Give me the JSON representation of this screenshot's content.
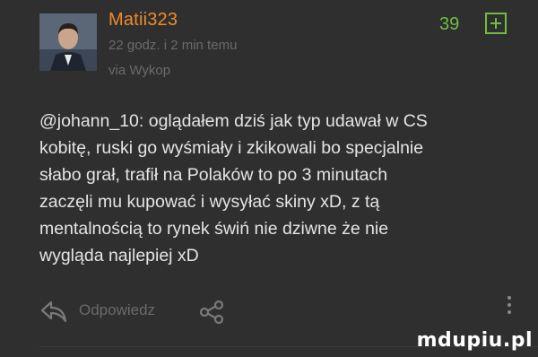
{
  "comment": {
    "author": "Matii323",
    "time": "22 godz. i 2 min temu",
    "via": "via Wykop",
    "votes": "39",
    "body_lines": [
      "@johann_10: oglądałem dziś jak typ udawał w CS",
      "kobitę, ruski go wyśmiały i zkikowali bo specjalnie",
      "słabo grał, trafił na Polaków to po 3 minutach",
      "zaczęli mu kupować i wysyłać skiny xD, z tą",
      "mentalnością to rynek świń nie dziwne że nie",
      "wygląda najlepiej xD"
    ]
  },
  "actions": {
    "reply_label": "Odpowiedz",
    "reply_icon": "reply-icon",
    "share_icon": "share-icon",
    "more_icon": "more-vertical-icon",
    "plus_icon": "plus-box-icon"
  },
  "watermark": "mdupiu.pl",
  "colors": {
    "background": "#2f2f2f",
    "author": "#f08a2c",
    "votes": "#6cbf3f",
    "body_text": "#e4e4e4",
    "muted_text": "#6b6b6b"
  }
}
